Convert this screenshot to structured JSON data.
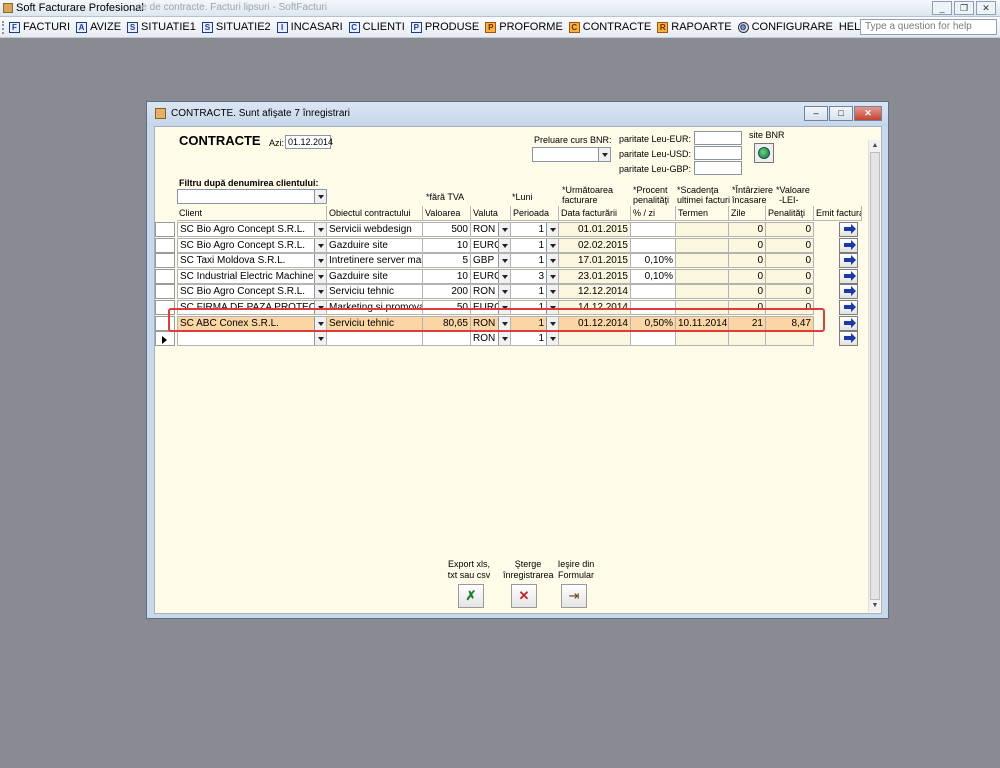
{
  "app": {
    "title": "Soft Facturare Profesional",
    "ghost_title": "...ce de contracte. Facturi lipsuri - SoftFacturi",
    "help_placeholder": "Type a question for help",
    "menu": [
      {
        "label": "FACTURI",
        "icon": "F"
      },
      {
        "label": "AVIZE",
        "icon": "A"
      },
      {
        "label": "SITUATIE1",
        "icon": "S"
      },
      {
        "label": "SITUATIE2",
        "icon": "S"
      },
      {
        "label": "INCASARI",
        "icon": "I"
      },
      {
        "label": "CLIENTI",
        "icon": "C"
      },
      {
        "label": "PRODUSE",
        "icon": "P"
      },
      {
        "label": "PROFORME",
        "icon": "P"
      },
      {
        "label": "CONTRACTE",
        "icon": "C"
      },
      {
        "label": "RAPOARTE",
        "icon": "R"
      },
      {
        "label": "CONFIGURARE",
        "icon": "gear"
      },
      {
        "label": "HELP",
        "icon": ""
      }
    ]
  },
  "dialog": {
    "title": "CONTRACTE. Sunt afişate 7 înregistrari",
    "heading": "CONTRACTE",
    "azi_label": "Azi:",
    "azi_value": "01.12.2014",
    "preluare_label": "Preluare curs BNR:",
    "paritate_eur": "paritate Leu-EUR:",
    "paritate_usd": "paritate Leu-USD:",
    "paritate_gbp": "paritate Leu-GBP:",
    "site_bnr": "site BNR",
    "filtru_label": "Filtru după denumirea clientului:"
  },
  "grid": {
    "top_labels": {
      "fara_tva": "*fără TVA",
      "luni": "*Luni",
      "urmatoarea": "*Următoarea",
      "facturare": "facturare",
      "procent": "*Procent",
      "penalitati": "penalităţi",
      "scadenta": "*Scadenţa",
      "ultimei": "ultimei facturi",
      "intarziere": "*Întârziere",
      "incasare": "încasare",
      "valoare": "*Valoare",
      "lei": "-LEI-"
    },
    "columns": [
      "Client",
      "Obiectul contractului",
      "Valoarea",
      "Valuta",
      "Perioada",
      "Data facturării",
      "% / zi",
      "Termen",
      "Zile",
      "Penalităţi",
      "Emit factura"
    ],
    "rows": [
      {
        "client": "SC Bio Agro Concept S.R.L.",
        "obiect": "Servicii webdesign",
        "valoare": "500",
        "valuta": "RON",
        "perioada": "1",
        "data": "01.01.2015",
        "procent": "",
        "termen": "",
        "zile": "0",
        "penalitati": "0"
      },
      {
        "client": "SC Bio Agro Concept S.R.L.",
        "obiect": "Gazduire site",
        "valoare": "10",
        "valuta": "EURO",
        "perioada": "1",
        "data": "02.02.2015",
        "procent": "",
        "termen": "",
        "zile": "0",
        "penalitati": "0"
      },
      {
        "client": "SC Taxi Moldova S.R.L.",
        "obiect": "Intretinere server mail",
        "valoare": "5",
        "valuta": "GBP",
        "perioada": "1",
        "data": "17.01.2015",
        "procent": "0,10%",
        "termen": "",
        "zile": "0",
        "penalitati": "0"
      },
      {
        "client": "SC Industrial Electric Machines S",
        "obiect": "Gazduire site",
        "valoare": "10",
        "valuta": "EURO",
        "perioada": "3",
        "data": "23.01.2015",
        "procent": "0,10%",
        "termen": "",
        "zile": "0",
        "penalitati": "0"
      },
      {
        "client": "SC Bio Agro Concept S.R.L.",
        "obiect": "Serviciu tehnic",
        "valoare": "200",
        "valuta": "RON",
        "perioada": "1",
        "data": "12.12.2014",
        "procent": "",
        "termen": "",
        "zile": "0",
        "penalitati": "0"
      },
      {
        "client": "SC FIRMA DE PAZA PROTECTIE",
        "obiect": "Marketing si promovare",
        "valoare": "50",
        "valuta": "EURO",
        "perioada": "1",
        "data": "14.12.2014",
        "procent": "",
        "termen": "",
        "zile": "0",
        "penalitati": "0"
      },
      {
        "client": "SC ABC Conex S.R.L.",
        "obiect": "Serviciu tehnic",
        "valoare": "80,65",
        "valuta": "RON",
        "perioada": "1",
        "data": "01.12.2014",
        "procent": "0,50%",
        "termen": "10.11.2014",
        "zile": "21",
        "penalitati": "8,47"
      }
    ],
    "new_row": {
      "valuta": "RON",
      "perioada": "1"
    }
  },
  "footer": {
    "export_label": "Export xls, txt sau csv",
    "sterge_label": "Şterge înregistrarea",
    "iesire_label": "Ieşire din Formular"
  }
}
